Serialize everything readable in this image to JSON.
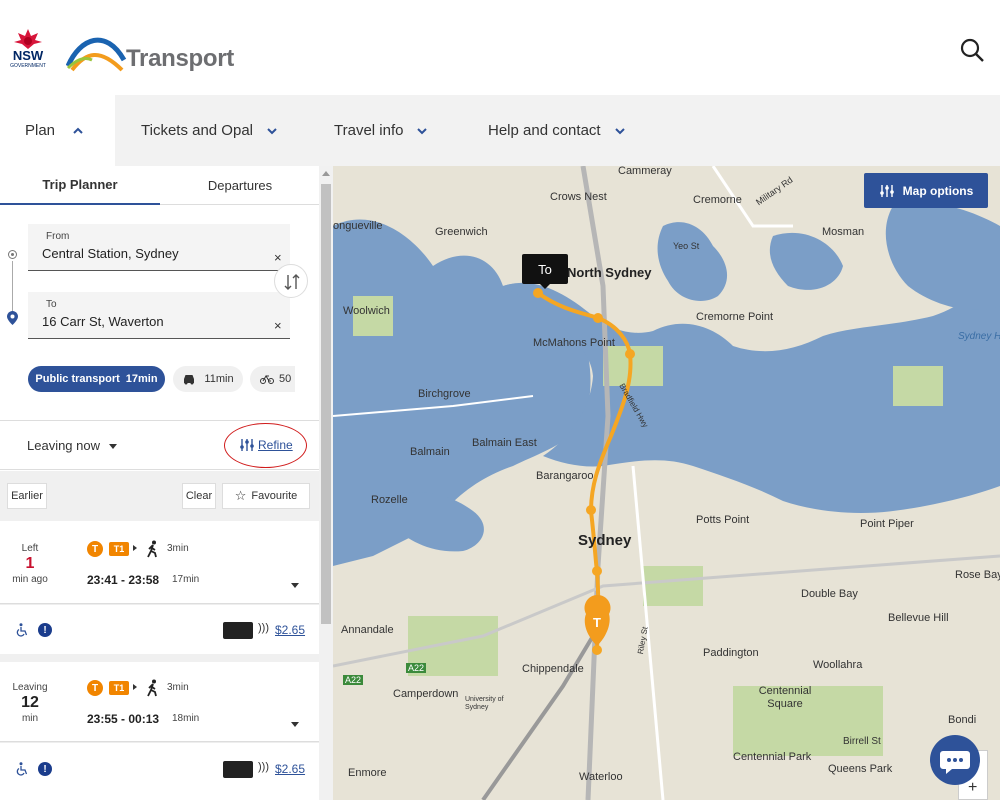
{
  "header": {
    "nsw_logo_text": "NSW",
    "nsw_logo_sub": "GOVERNMENT",
    "brand": "Transport"
  },
  "nav": [
    {
      "label": "Plan",
      "expanded": true
    },
    {
      "label": "Tickets and Opal"
    },
    {
      "label": "Travel info"
    },
    {
      "label": "Help and contact"
    }
  ],
  "tabs": {
    "trip_planner": "Trip Planner",
    "departures": "Departures"
  },
  "trip_form": {
    "from_label": "From",
    "from_value": "Central Station, Sydney",
    "to_label": "To",
    "to_value": "16 Carr St, Waverton",
    "clear_symbol": "×"
  },
  "modes": {
    "public_transport": "Public transport",
    "public_transport_time": "17min",
    "car_time": "11min",
    "bike_time": "50"
  },
  "options": {
    "leaving": "Leaving now",
    "refine": "Refine",
    "earlier": "Earlier",
    "clear": "Clear",
    "favourite": "Favourite"
  },
  "trips": [
    {
      "status_label": "Left",
      "minutes": "1",
      "unit": "min ago",
      "mode_badge": "T",
      "line": "T1",
      "walk_min": "3min",
      "times": "23:41 - 23:58",
      "duration": "17min",
      "fare": "$2.65",
      "info_symbol": "!",
      "minutes_color": "#c8102e"
    },
    {
      "status_label": "Leaving",
      "minutes": "12",
      "unit": "min",
      "mode_badge": "T",
      "line": "T1",
      "walk_min": "3min",
      "times": "23:55 - 00:13",
      "duration": "18min",
      "fare": "$2.65",
      "info_symbol": "!",
      "minutes_color": "#222222"
    }
  ],
  "map": {
    "options_label": "Map options",
    "to_tooltip": "To",
    "labels": {
      "sydney": "Sydney",
      "north_sydney": "North Sydney",
      "cammeray": "Cammeray",
      "crows_nest": "Crows Nest",
      "cremorne": "Cremorne",
      "mosman": "Mosman",
      "greenwich": "Greenwich",
      "longueville": "ongueville",
      "woolwich": "Woolwich",
      "mcmahons_point": "McMahons Point",
      "cremorne_point": "Cremorne Point",
      "sydney_harbour": "Sydney H",
      "birchgrove": "Birchgrove",
      "balmain_east": "Balmain East",
      "balmain": "Balmain",
      "barangaroo": "Barangaroo",
      "rozelle": "Rozelle",
      "potts_point": "Potts Point",
      "point_piper": "Point Piper",
      "rose_bay": "Rose Bay",
      "double_bay": "Double Bay",
      "bellevue_hill": "Bellevue Hill",
      "annandale": "Annandale",
      "chippendale": "Chippendale",
      "paddington": "Paddington",
      "woollahra": "Woollahra",
      "camperdown": "Camperdown",
      "university": "University of Sydney",
      "centennial_square": "Centennial Square",
      "bondi": "Bondi",
      "birrell": "Birrell St",
      "centennial_park": "Centennial Park",
      "queens_park": "Queens Park",
      "enmore": "Enmore",
      "waterloo": "Waterloo",
      "a22": "A22",
      "a22b": "A22",
      "military_rd": "Military Rd",
      "yeo_st": "Yeo St",
      "bradfield": "Bradfield Hwy",
      "riley_st": "Riley St"
    },
    "route_color": "#f5a623",
    "water_color": "#7b9ec7",
    "land_color": "#e7e3d6",
    "park_color": "#c5d9a5"
  }
}
